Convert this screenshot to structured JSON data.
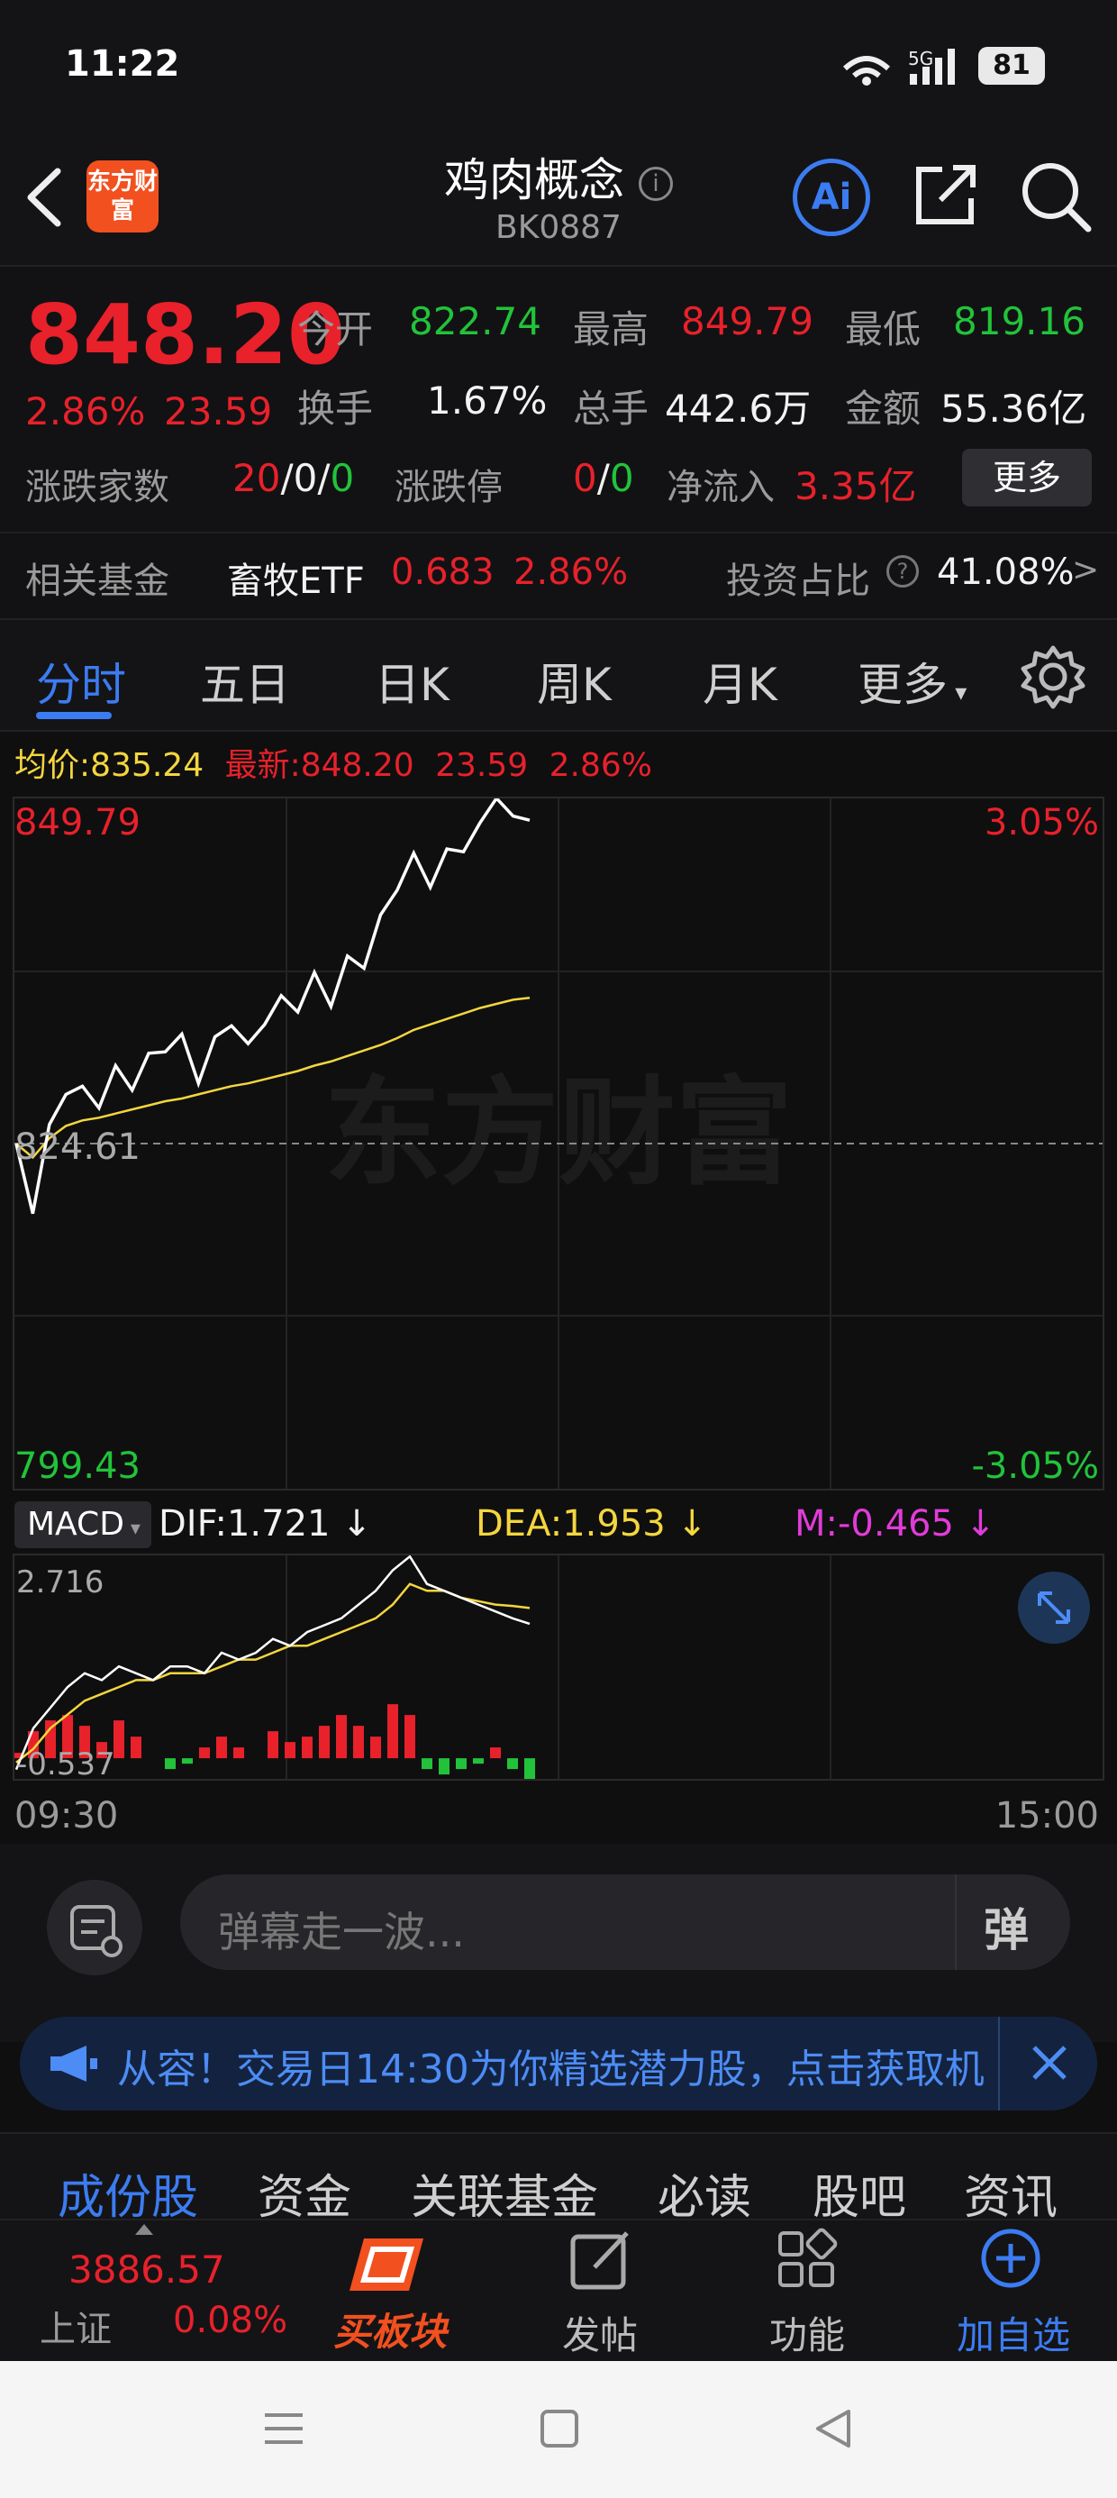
{
  "status": {
    "time": "11:22",
    "signal": "5G",
    "battery": "81"
  },
  "header": {
    "title": "鸡肉概念",
    "code": "BK0887",
    "logo_text": "东方财富"
  },
  "quote": {
    "price": "848.20",
    "change_pct": "2.86%",
    "change": "23.59",
    "open_label": "今开",
    "open": "822.74",
    "high_label": "最高",
    "high": "849.79",
    "low_label": "最低",
    "low": "819.16",
    "turnover_label": "换手",
    "turnover": "1.67%",
    "volume_label": "总手",
    "volume": "442.6万",
    "amount_label": "金额",
    "amount": "55.36亿",
    "breadth_label": "涨跌家数",
    "breadth_up": "20",
    "breadth_flat": "0",
    "breadth_down": "0",
    "limit_label": "涨跌停",
    "limit_up": "0",
    "limit_down": "0",
    "inflow_label": "净流入",
    "inflow": "3.35亿",
    "more_label": "更多",
    "fund_label": "相关基金",
    "fund_name": "畜牧ETF",
    "fund_price": "0.683",
    "fund_pct": "2.86%",
    "ratio_label": "投资占比",
    "ratio": "41.08%",
    "ratio_arrow": ">"
  },
  "tabs": [
    "分时",
    "五日",
    "日K",
    "周K",
    "月K",
    "更多"
  ],
  "chart_info": {
    "avg_label": "均价:",
    "avg": "835.24",
    "latest_label": "最新:",
    "latest": "848.20",
    "latest_change": "23.59",
    "latest_pct": "2.86%",
    "watermark": "东方财富"
  },
  "chart_data": {
    "type": "line",
    "y_top": "849.79",
    "y_mid": "824.61",
    "y_bottom": "799.43",
    "pct_top": "3.05%",
    "pct_bottom": "-3.05%",
    "ylim": [
      799.43,
      849.79
    ],
    "x_start": "09:30",
    "x_end": "15:00",
    "series": [
      {
        "name": "最新",
        "values": [
          824.6,
          819.5,
          826.0,
          828.2,
          828.8,
          827.2,
          830.3,
          828.5,
          831.2,
          831.3,
          832.6,
          829.0,
          832.4,
          833.2,
          831.9,
          833.3,
          835.4,
          834.2,
          837.1,
          834.6,
          838.3,
          837.4,
          841.3,
          843.1,
          845.8,
          843.3,
          846.1,
          845.9,
          848.0,
          849.8,
          848.5,
          848.2
        ]
      },
      {
        "name": "均价",
        "values": [
          824.6,
          823.6,
          825.0,
          825.9,
          826.3,
          826.5,
          826.8,
          827.1,
          827.4,
          827.7,
          827.9,
          828.2,
          828.5,
          828.8,
          829.0,
          829.3,
          829.6,
          829.9,
          830.3,
          830.6,
          831.0,
          831.4,
          831.8,
          832.3,
          832.9,
          833.3,
          833.7,
          834.1,
          834.5,
          834.8,
          835.1,
          835.24
        ]
      }
    ]
  },
  "macd": {
    "label": "MACD",
    "dif_label": "DIF:",
    "dif": "1.721",
    "dea_label": "DEA:",
    "dea": "1.953",
    "m_label": "M:",
    "m": "-0.465",
    "y_top": "2.716",
    "y_bottom": "-0.537",
    "ylim": [
      -0.537,
      2.716
    ],
    "dif_values": [
      -0.4,
      0.2,
      0.5,
      0.8,
      1.0,
      0.9,
      1.1,
      1.0,
      0.9,
      1.1,
      1.1,
      1.0,
      1.3,
      1.2,
      1.3,
      1.5,
      1.4,
      1.6,
      1.7,
      1.8,
      2.0,
      2.2,
      2.5,
      2.7,
      2.3,
      2.2,
      2.1,
      2.0,
      1.9,
      1.8,
      1.72
    ],
    "dea_values": [
      -0.3,
      -0.1,
      0.2,
      0.4,
      0.6,
      0.7,
      0.8,
      0.9,
      0.9,
      1.0,
      1.0,
      1.0,
      1.1,
      1.2,
      1.2,
      1.3,
      1.4,
      1.4,
      1.5,
      1.6,
      1.7,
      1.8,
      2.0,
      2.3,
      2.2,
      2.2,
      2.1,
      2.05,
      2.0,
      1.98,
      1.95
    ],
    "m_values": [
      0.1,
      0.5,
      0.7,
      0.8,
      0.6,
      0.3,
      0.7,
      0.4,
      0.0,
      -0.2,
      -0.1,
      0.2,
      0.4,
      0.2,
      0.0,
      0.5,
      0.3,
      0.4,
      0.6,
      0.8,
      0.6,
      0.4,
      1.0,
      0.8,
      -0.2,
      -0.3,
      -0.2,
      -0.1,
      0.2,
      -0.2,
      -0.465
    ]
  },
  "danmaku": {
    "placeholder": "弹幕走一波...",
    "button": "弹"
  },
  "ad": {
    "text": "从容！交易日14:30为你精选潜力股，点击获取机"
  },
  "sub_tabs": [
    "成份股",
    "资金",
    "关联基金",
    "必读",
    "股吧",
    "资讯"
  ],
  "bottom": {
    "index_value": "3886.57",
    "index_name": "上证",
    "index_pct": "0.08%",
    "buy_label": "买板块",
    "post_label": "发帖",
    "func_label": "功能",
    "add_label": "加自选"
  },
  "colors": {
    "up": "#e8212b",
    "down": "#22c33a",
    "accent": "#3c7cf2",
    "avg": "#f4d63e"
  }
}
